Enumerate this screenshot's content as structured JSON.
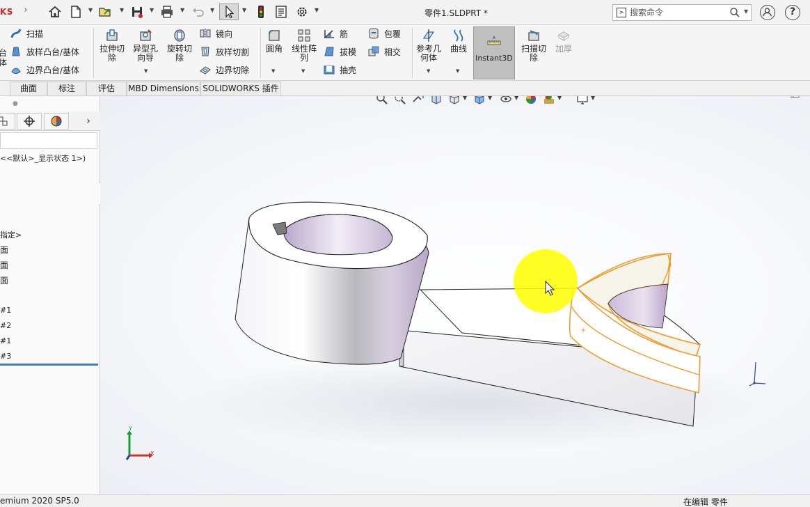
{
  "title_bar": {
    "logo_text": "KS",
    "document_title": "零件1.SLDPRT *",
    "search_placeholder": "搜索命令"
  },
  "ribbon": {
    "group1": {
      "sweep": "扫描",
      "loft_boss": "放样凸台/基体",
      "boundary_boss": "边界凸台/基体",
      "cut_off_label_1": "台",
      "cut_off_label_2": "体"
    },
    "group2": {
      "extruded_cut": [
        "拉伸切",
        "除"
      ],
      "hole_wizard": [
        "异型孔",
        "向导"
      ],
      "revolved_cut": [
        "旋转切",
        "除"
      ],
      "mirror": "镜向",
      "lofted_cut": "放样切割",
      "boundary_cut": "边界切除"
    },
    "group3": {
      "fillet": "圆角",
      "linear_pattern": [
        "线性阵",
        "列"
      ],
      "rib": "筋",
      "draft": "拔模",
      "shell": "抽壳",
      "wrap": "包覆",
      "intersect": "相交"
    },
    "group4": {
      "reference_geometry": [
        "参考几",
        "何体"
      ],
      "curves": "曲线",
      "instant3d": "Instant3D",
      "swept_cut": [
        "扫描切",
        "除"
      ],
      "thicken": "加厚"
    }
  },
  "tabs": [
    "曲面",
    "标注",
    "评估",
    "MBD Dimensions",
    "SOLIDWORKS 插件"
  ],
  "feature_tree": {
    "display_state": "<<默认>_显示状态 1>)",
    "items": [
      "指定>",
      "面",
      "面",
      "面",
      "#1",
      "#2",
      "#1",
      "#3"
    ]
  },
  "triad": {
    "x_label": "x",
    "y_label": "Y"
  },
  "status_bar": {
    "version": "emium 2020 SP5.0",
    "editing_label": "在编辑 零件"
  },
  "colors": {
    "selection_edge": "#f29b2c",
    "inner_face": "#c8b3d3",
    "highlight_circle": "#ffff00",
    "rollback_bar": "#3d7fc1"
  }
}
